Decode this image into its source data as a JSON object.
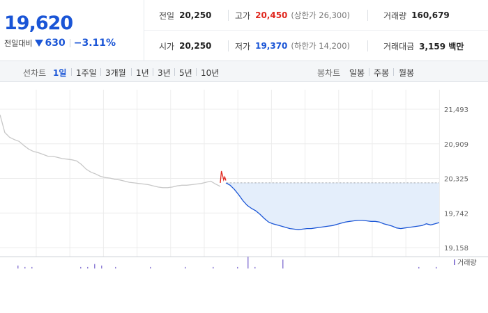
{
  "summary": {
    "current_price": "19,620",
    "change_label": "전일대비",
    "change_value": "630",
    "change_percent": "−3.11%",
    "direction": "down",
    "prev_close": {
      "label": "전일",
      "value": "20,250"
    },
    "high": {
      "label": "고가",
      "value": "20,450",
      "limit_text": "(상한가 26,300)"
    },
    "volume": {
      "label": "거래량",
      "value": "160,679"
    },
    "open": {
      "label": "시가",
      "value": "20,250"
    },
    "low": {
      "label": "저가",
      "value": "19,370",
      "limit_text": "(하한가 14,200)"
    },
    "trade_value": {
      "label": "거래대금",
      "value": "3,159 백만"
    }
  },
  "colors": {
    "up": "#e0281f",
    "down": "#1a55d6",
    "prior_line": "#c8c8c8",
    "fill": "#e4eefb"
  },
  "toolbar": {
    "line_chart_label": "선차트",
    "periods": [
      "1일",
      "1주일",
      "3개월",
      "1년",
      "3년",
      "5년",
      "10년"
    ],
    "active_period": "1일",
    "candle_chart_label": "봉차트",
    "candle_periods": [
      "일봉",
      "주봉",
      "월봉"
    ]
  },
  "chart_data": {
    "type": "line",
    "y_ticks": [
      "21,493",
      "20,909",
      "20,325",
      "19,742",
      "19,158"
    ],
    "ylim": [
      19158,
      21493
    ],
    "reference_price": 20250,
    "volume_legend": "거래량",
    "series": [
      {
        "role": "prior_period",
        "values": [
          21400,
          21100,
          21020,
          20980,
          20950,
          20880,
          20820,
          20780,
          20760,
          20730,
          20700,
          20700,
          20680,
          20660,
          20650,
          20640,
          20620,
          20560,
          20480,
          20430,
          20400,
          20360,
          20340,
          20330,
          20310,
          20300,
          20280,
          20260,
          20250,
          20240,
          20230,
          20220,
          20200,
          20180,
          20170,
          20170,
          20180,
          20200,
          20210,
          20210,
          20220,
          20230,
          20240,
          20260,
          20280,
          20230,
          20190
        ]
      },
      {
        "role": "today_above_reference",
        "values": [
          20250,
          20450,
          20380,
          20300,
          20350,
          20290
        ]
      },
      {
        "role": "today",
        "values": [
          20250,
          20210,
          20140,
          20050,
          19950,
          19870,
          19820,
          19780,
          19720,
          19650,
          19590,
          19560,
          19540,
          19520,
          19500,
          19480,
          19470,
          19460,
          19470,
          19480,
          19480,
          19490,
          19500,
          19510,
          19520,
          19530,
          19550,
          19570,
          19590,
          19600,
          19610,
          19620,
          19620,
          19610,
          19600,
          19600,
          19590,
          19560,
          19540,
          19520,
          19490,
          19480,
          19490,
          19500,
          19510,
          19520,
          19530,
          19560,
          19540,
          19560,
          19580
        ]
      }
    ],
    "volume_values": [
      0,
      0,
      0,
      0,
      2,
      0,
      1,
      0,
      1,
      0,
      0,
      0,
      0,
      0,
      0,
      0,
      0,
      0,
      0,
      0,
      0,
      0,
      1,
      0,
      1,
      0,
      3,
      0,
      2,
      0,
      0,
      0,
      1,
      0,
      0,
      0,
      0,
      0,
      0,
      0,
      0,
      0,
      1,
      0,
      0,
      0,
      0,
      0,
      0,
      0,
      0,
      0,
      1,
      0,
      0,
      0,
      0,
      0,
      0,
      0,
      1,
      0,
      0,
      0,
      0,
      0,
      0,
      1,
      0,
      0,
      8,
      0,
      1,
      0,
      0,
      0,
      0,
      0,
      0,
      0,
      6,
      0,
      0,
      0,
      0,
      0,
      0,
      0,
      0,
      0,
      0,
      0,
      0,
      0,
      0,
      0,
      0,
      0,
      0,
      0,
      0,
      0,
      0,
      0,
      0,
      0,
      0,
      0,
      0,
      0,
      0,
      0,
      0,
      0,
      0,
      0,
      0,
      0,
      0,
      1,
      0,
      0,
      0,
      0,
      1
    ]
  }
}
